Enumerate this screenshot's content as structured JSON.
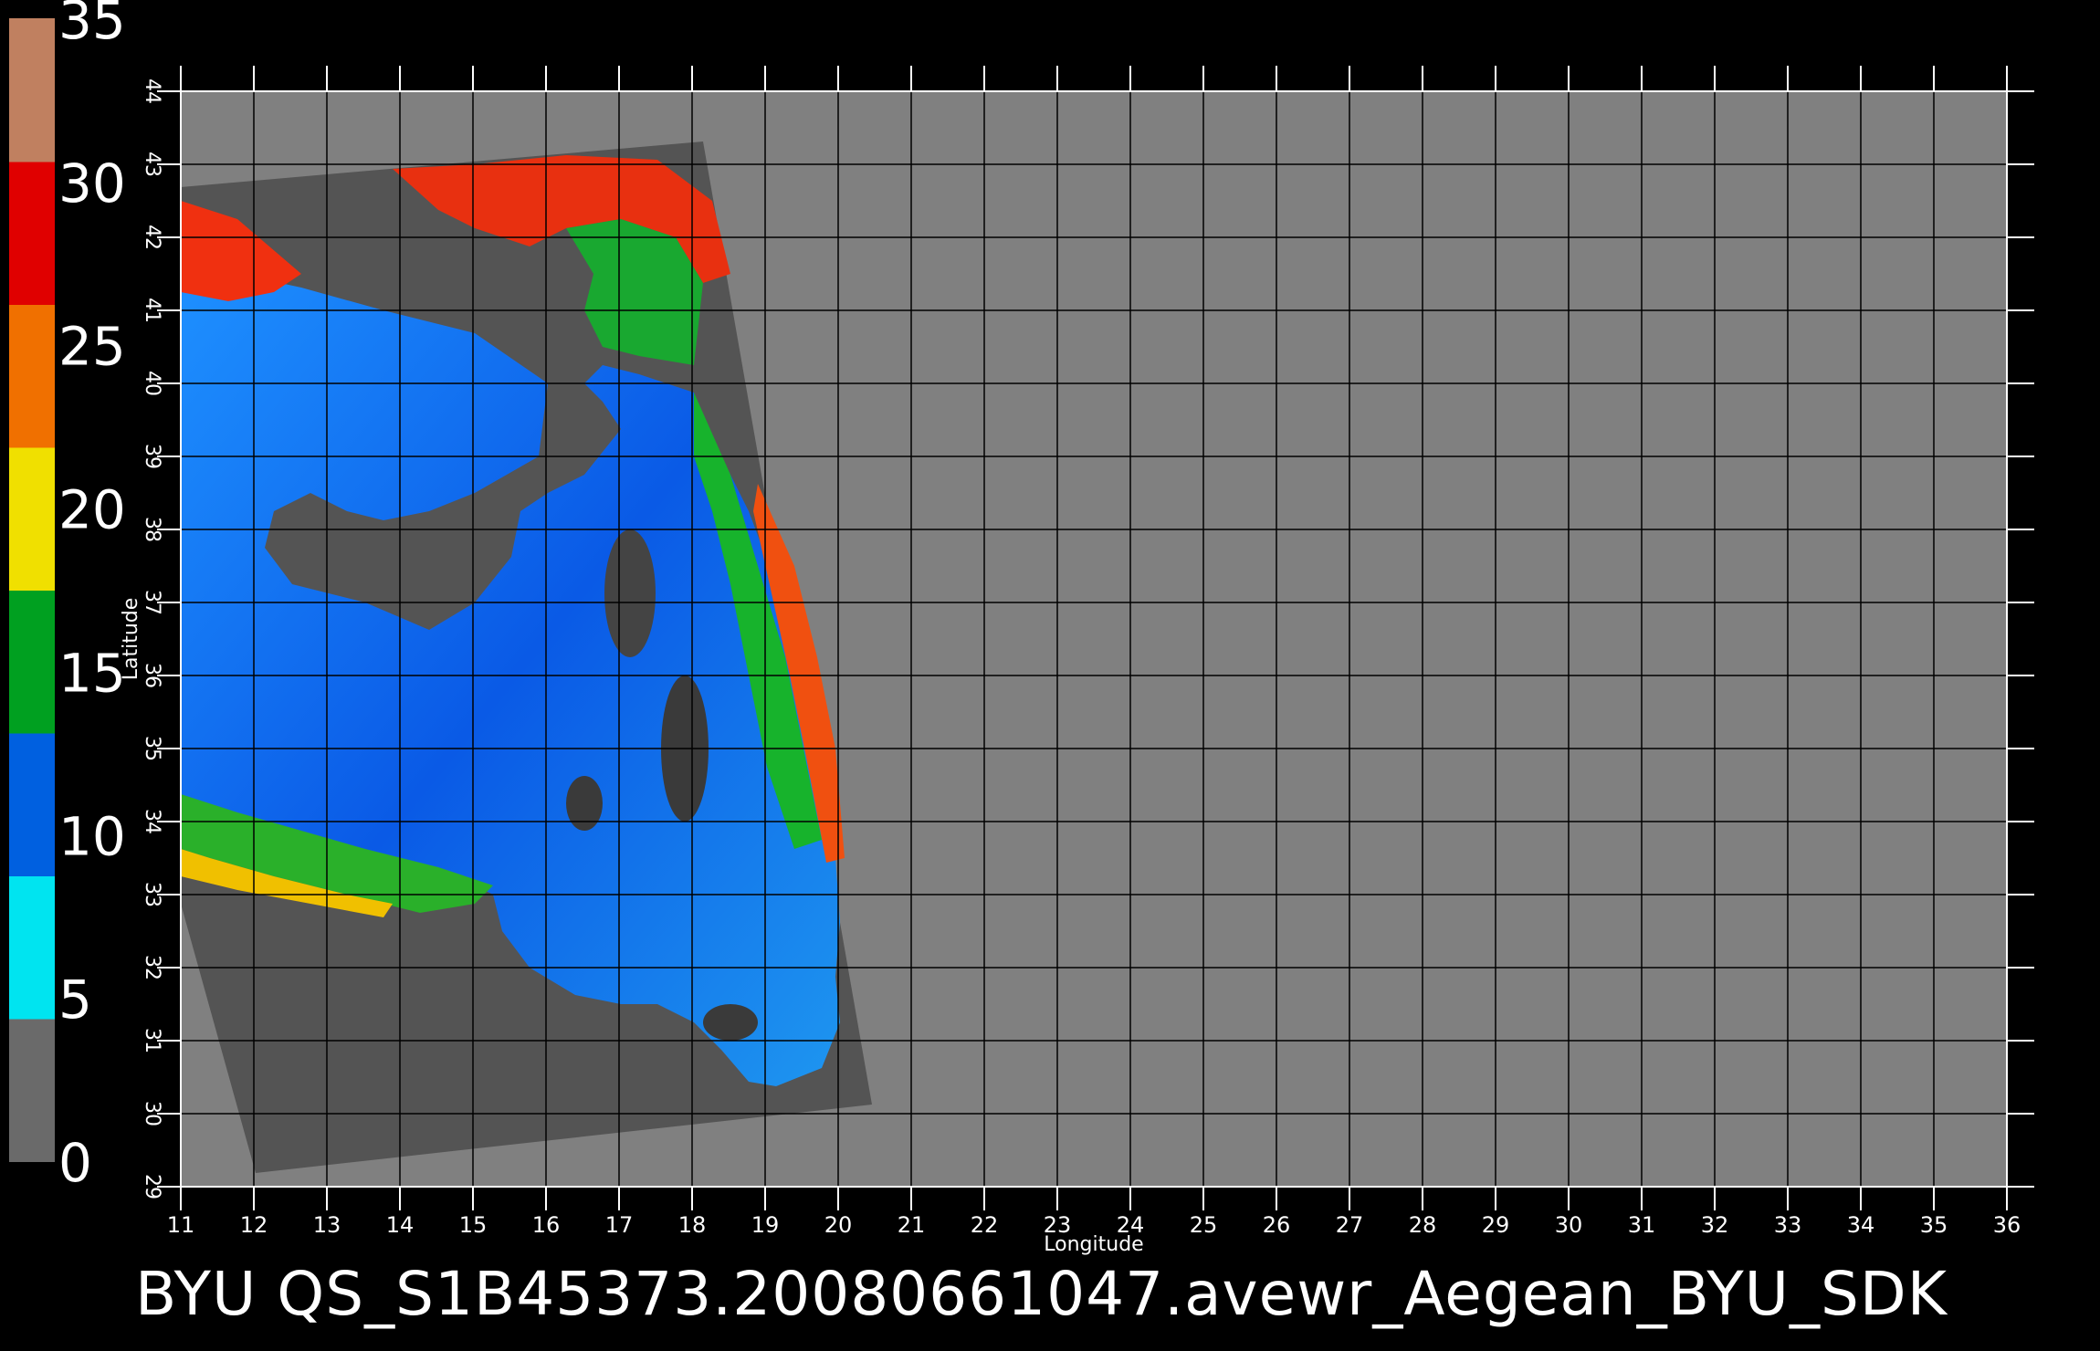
{
  "footer": {
    "title": "BYU  QS_S1B45373.20080661047.avewr_Aegean_BYU_SDK"
  },
  "map": {
    "x_label": "Longitude",
    "y_label": "Latitude",
    "lon_range": [
      11,
      36
    ],
    "lat_range": [
      29,
      44
    ],
    "lon_ticks": [
      "11",
      "12",
      "13",
      "14",
      "15",
      "16",
      "17",
      "18",
      "19",
      "20",
      "21",
      "22",
      "23",
      "24",
      "25",
      "26",
      "27",
      "28",
      "29",
      "30",
      "31",
      "32",
      "33",
      "34",
      "35",
      "36"
    ],
    "lat_ticks": [
      "29",
      "30",
      "31",
      "32",
      "33",
      "34",
      "35",
      "36",
      "37",
      "38",
      "39",
      "40",
      "41",
      "42",
      "43",
      "44"
    ],
    "colors": {
      "background": "#000000",
      "no_data": "#808080",
      "land": "#555555",
      "grid": "#000000"
    }
  },
  "colorbar": {
    "labels": [
      "0",
      "5",
      "10",
      "15",
      "20",
      "25",
      "30",
      "35"
    ],
    "range": [
      0,
      35
    ],
    "segments": [
      {
        "color": "#6a6a6a"
      },
      {
        "color": "#00e4f0"
      },
      {
        "color": "#0060e0"
      },
      {
        "color": "#00a020"
      },
      {
        "color": "#f0e000"
      },
      {
        "color": "#f07000"
      },
      {
        "color": "#e00000"
      },
      {
        "color": "#c08060"
      }
    ]
  }
}
